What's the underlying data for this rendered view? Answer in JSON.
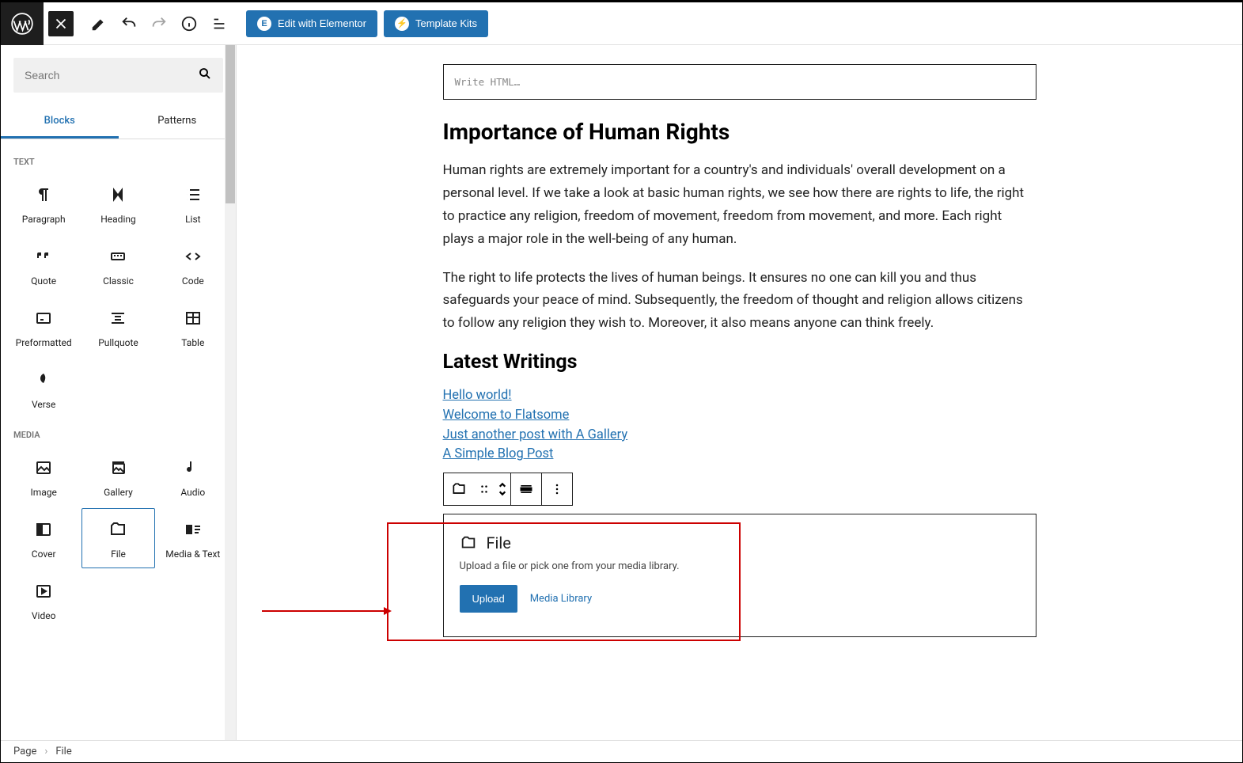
{
  "topbar": {
    "elementor_label": "Edit with Elementor",
    "kits_label": "Template Kits"
  },
  "sidebar": {
    "search_placeholder": "Search",
    "tabs": {
      "blocks": "Blocks",
      "patterns": "Patterns"
    },
    "sections": {
      "text": "Text",
      "media": "Media"
    },
    "text_blocks": [
      {
        "label": "Paragraph"
      },
      {
        "label": "Heading"
      },
      {
        "label": "List"
      },
      {
        "label": "Quote"
      },
      {
        "label": "Classic"
      },
      {
        "label": "Code"
      },
      {
        "label": "Preformatted"
      },
      {
        "label": "Pullquote"
      },
      {
        "label": "Table"
      },
      {
        "label": "Verse"
      }
    ],
    "media_blocks": [
      {
        "label": "Image"
      },
      {
        "label": "Gallery"
      },
      {
        "label": "Audio"
      },
      {
        "label": "Cover"
      },
      {
        "label": "File",
        "selected": true
      },
      {
        "label": "Media & Text"
      },
      {
        "label": "Video"
      }
    ]
  },
  "content": {
    "html_placeholder": "Write HTML…",
    "h2a": "Importance of Human Rights",
    "p1": "Human rights are extremely important for a country's and individuals' overall development on a personal level. If we take a look at basic human rights, we see how there are rights to life, the right to practice any religion, freedom of movement, freedom from movement, and more. Each right plays a major role in the well-being of any human.",
    "p2": "The right to life protects the lives of human beings. It ensures no one can kill you and thus safeguards your peace of mind. Subsequently, the freedom of thought and religion allows citizens to follow any religion they wish to. Moreover, it also means anyone can think freely.",
    "h2b": "Latest Writings",
    "links": [
      "Hello world!",
      "Welcome to Flatsome",
      "Just another post with A Gallery",
      "A Simple Blog Post"
    ],
    "file_block": {
      "title": "File",
      "desc": "Upload a file or pick one from your media library.",
      "upload": "Upload",
      "media": "Media Library"
    }
  },
  "breadcrumb": {
    "a": "Page",
    "b": "File"
  }
}
